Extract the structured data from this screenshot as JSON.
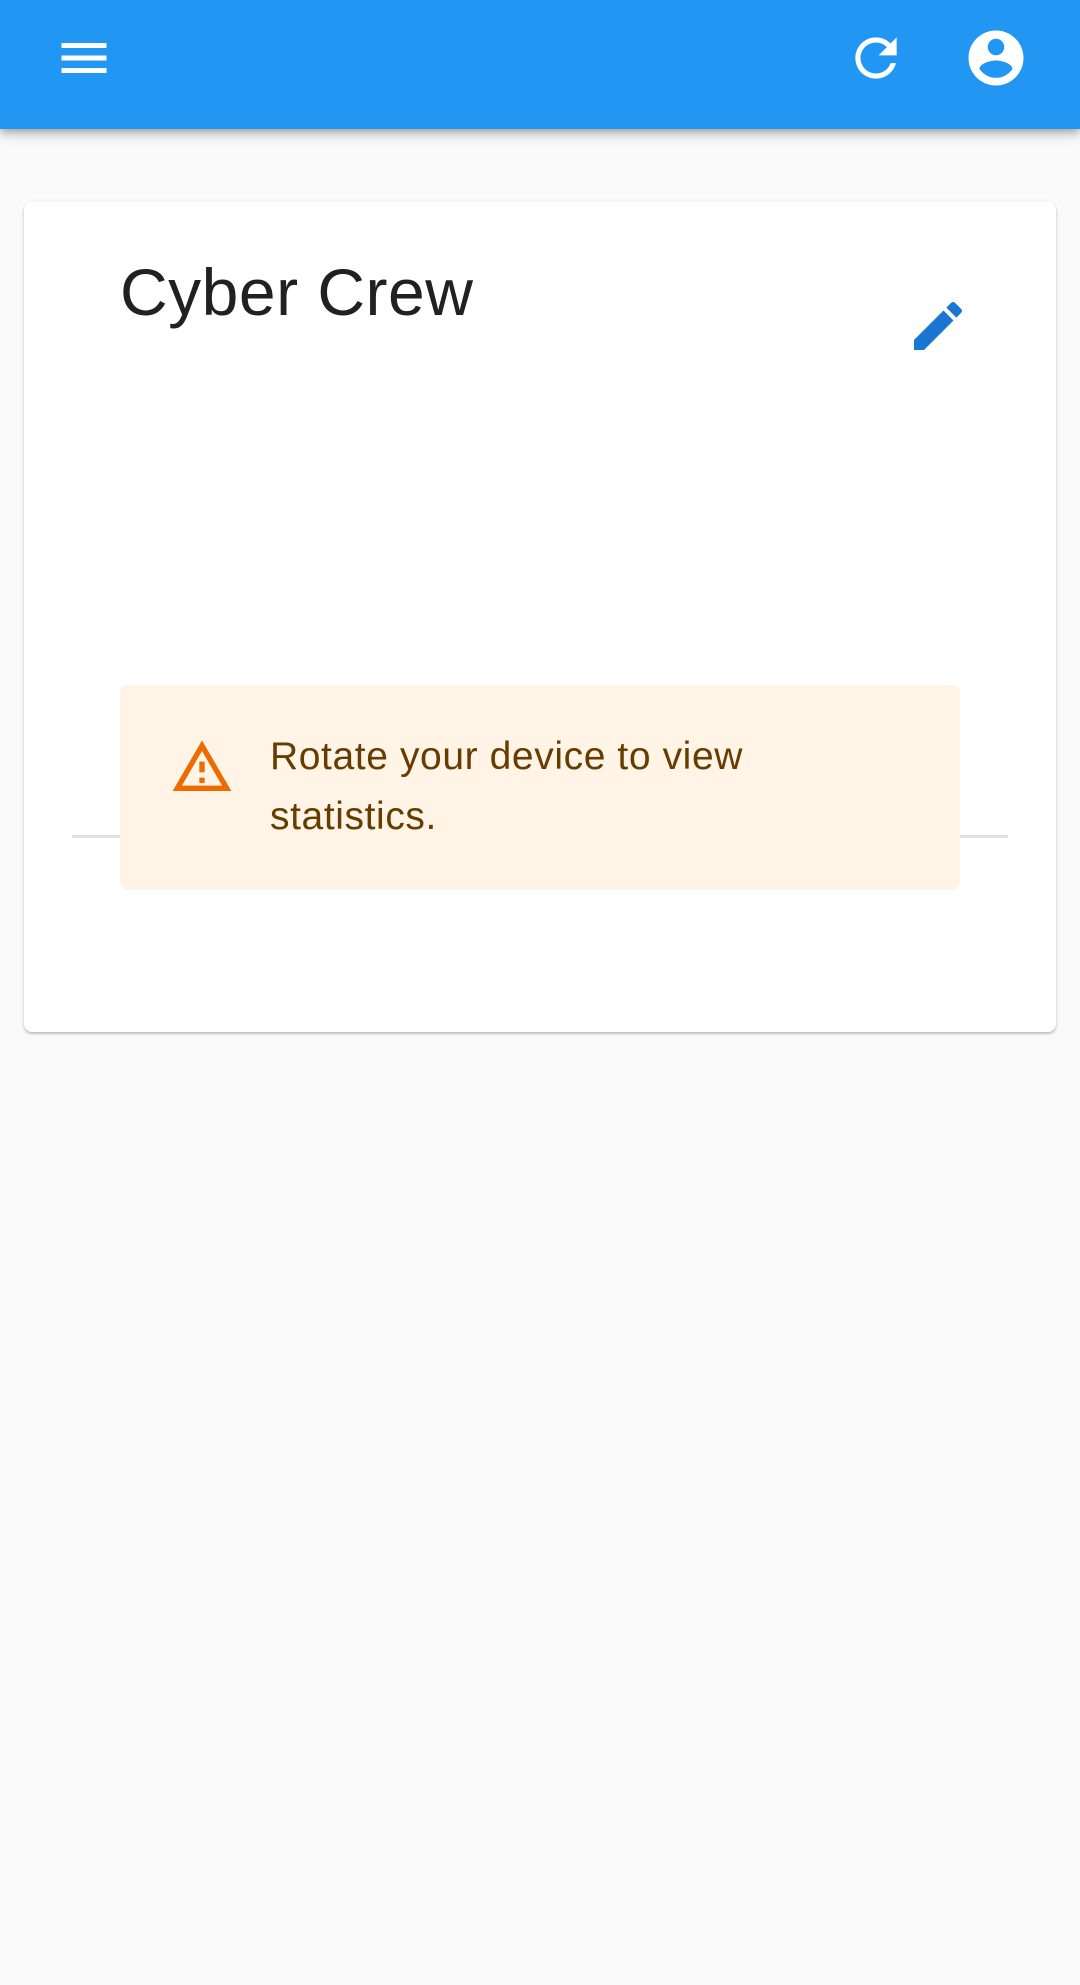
{
  "app_bar": {
    "background": "#2196f3",
    "menu_icon": "menu-icon",
    "refresh_icon": "refresh-icon",
    "account_icon": "account-circle-icon"
  },
  "card": {
    "title": "Cyber Crew",
    "edit_icon": "edit-pencil-icon",
    "tabs": [
      {
        "icon": "info-icon",
        "selected": false
      },
      {
        "icon": "account-tree-icon",
        "selected": false
      },
      {
        "icon": "bar-chart-icon",
        "selected": true
      }
    ],
    "alert": {
      "severity": "warning",
      "icon": "warning-triangle-icon",
      "message": "Rotate your device to view statistics.",
      "background": "#fff4e5",
      "text_color": "#663c00"
    }
  },
  "colors": {
    "primary": "#2196f3",
    "accent": "#1976d2",
    "warning": "#ed6c02",
    "icon_inactive": "#616161"
  }
}
